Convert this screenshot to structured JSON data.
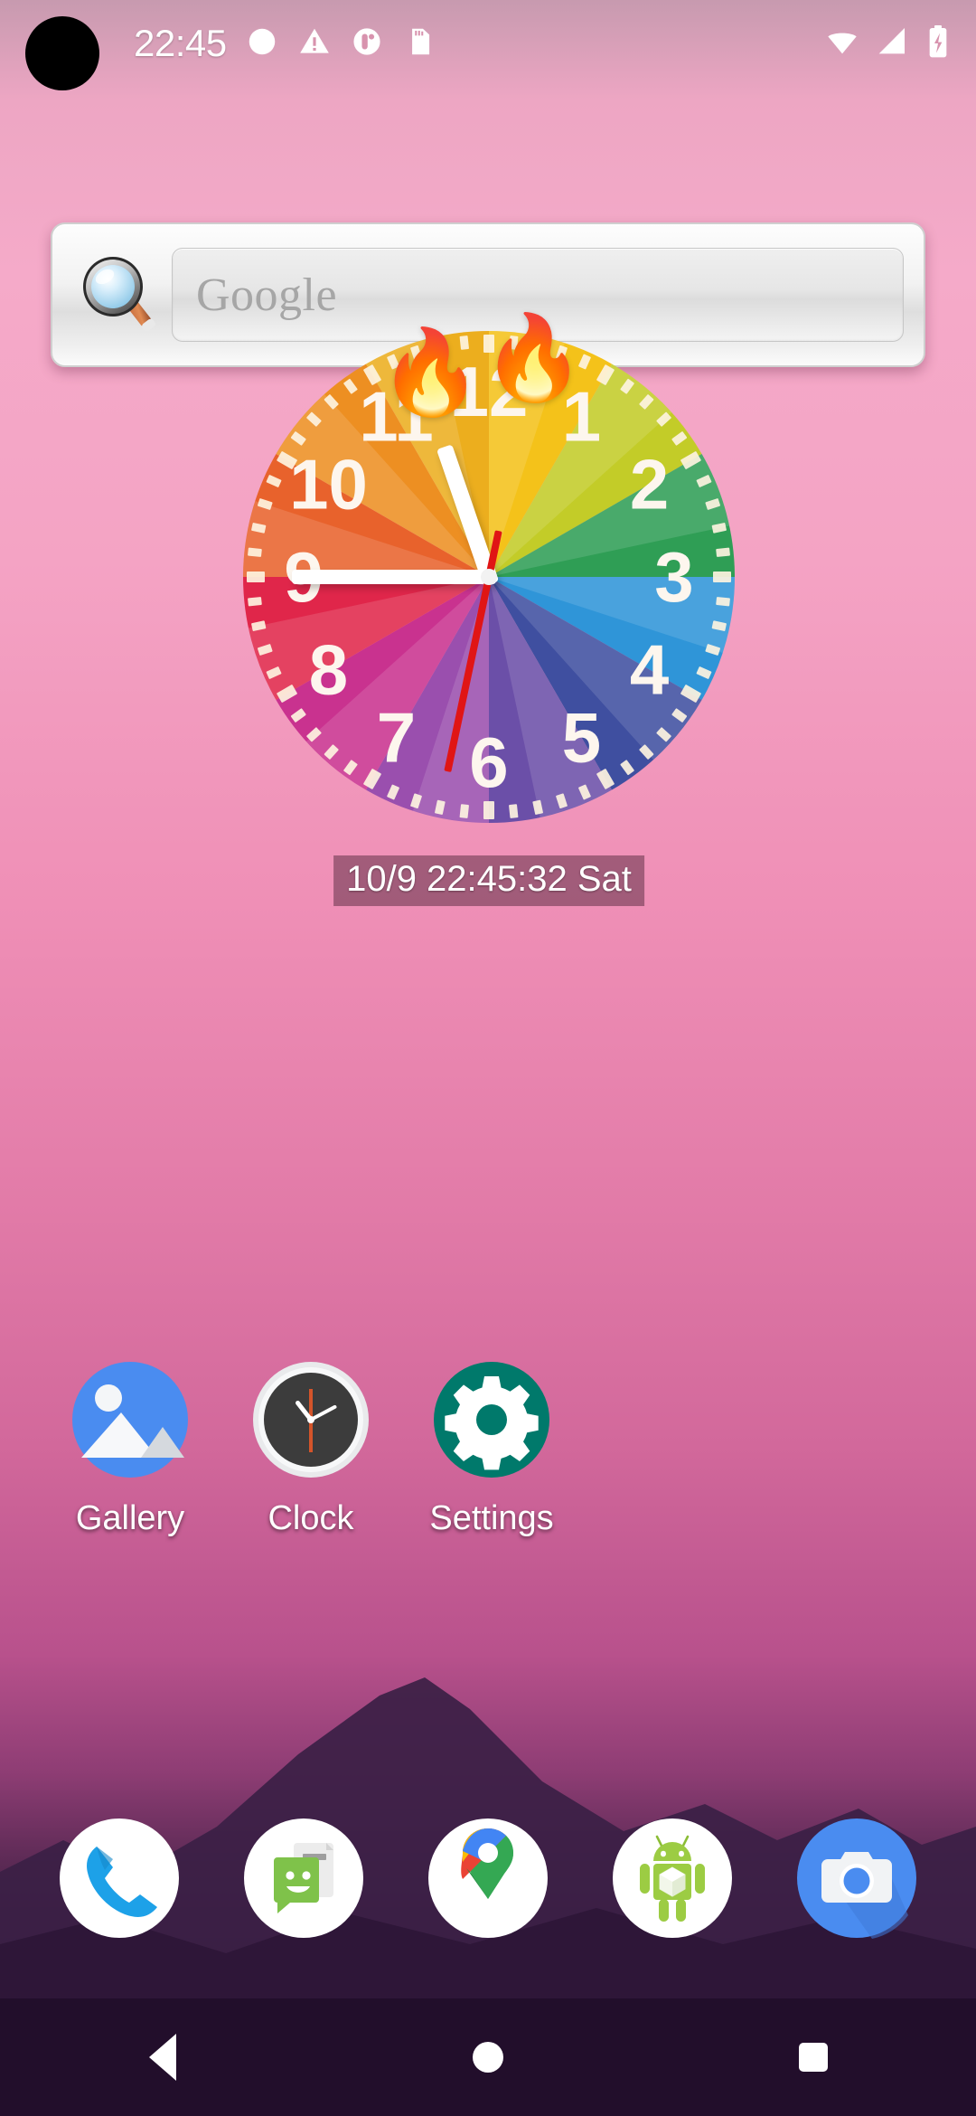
{
  "status_bar": {
    "clock": "22:45",
    "left_icons": [
      {
        "name": "circle-notification-icon",
        "glyph": "circle"
      },
      {
        "name": "warning-triangle-icon",
        "glyph": "warning"
      },
      {
        "name": "vpn-key-icon",
        "glyph": "key"
      },
      {
        "name": "sd-card-icon",
        "glyph": "sdcard"
      }
    ],
    "right_icons": [
      {
        "name": "wifi-icon",
        "glyph": "wifi"
      },
      {
        "name": "cellular-signal-icon",
        "glyph": "signal"
      },
      {
        "name": "battery-charging-icon",
        "glyph": "battery-charging"
      }
    ],
    "camera_cutout": "front-camera-cutout"
  },
  "search_widget": {
    "placeholder": "Google",
    "icon": "magnifier-icon"
  },
  "clock_widget": {
    "date_label": "10/9 22:45:32 Sat",
    "hour_numbers": [
      "12",
      "1",
      "2",
      "3",
      "4",
      "5",
      "6",
      "7",
      "8",
      "9",
      "10",
      "11"
    ],
    "hour_hand_deg": 341,
    "minute_hand_deg": 270,
    "second_hand_deg": 192,
    "decorations": [
      {
        "name": "flame-emoji-11",
        "glyph": "🔥"
      },
      {
        "name": "flame-emoji-12",
        "glyph": "🔥"
      }
    ],
    "wedge_colors": [
      "#f4c21a",
      "#c3cc28",
      "#2f9e55",
      "#2f95d8",
      "#3f4fa0",
      "#6b4fa8",
      "#9a4fae",
      "#c9328f",
      "#e0264a",
      "#e8622c",
      "#ed8f22",
      "#ecae1e"
    ],
    "hand_color": "#ffffff",
    "second_hand_color": "#e01515"
  },
  "apps": [
    {
      "label": "Gallery",
      "icon": "gallery-icon"
    },
    {
      "label": "Clock",
      "icon": "clock-icon"
    },
    {
      "label": "Settings",
      "icon": "settings-gear-icon"
    }
  ],
  "dock": [
    {
      "label": "Phone",
      "icon": "phone-icon"
    },
    {
      "label": "Messaging",
      "icon": "messaging-icon"
    },
    {
      "label": "Maps",
      "icon": "maps-pin-icon"
    },
    {
      "label": "App Installer",
      "icon": "android-robot-icon"
    },
    {
      "label": "Camera",
      "icon": "camera-icon"
    }
  ],
  "nav_bar": [
    {
      "label": "Back",
      "icon": "back-triangle-icon"
    },
    {
      "label": "Home",
      "icon": "home-circle-icon"
    },
    {
      "label": "Recents",
      "icon": "recents-square-icon"
    }
  ],
  "colors": {
    "wallpaper_top": "#eda6c3",
    "wallpaper_mid": "#e27ba8",
    "wallpaper_bottom": "#271230",
    "mountain": "#3b1f45"
  }
}
